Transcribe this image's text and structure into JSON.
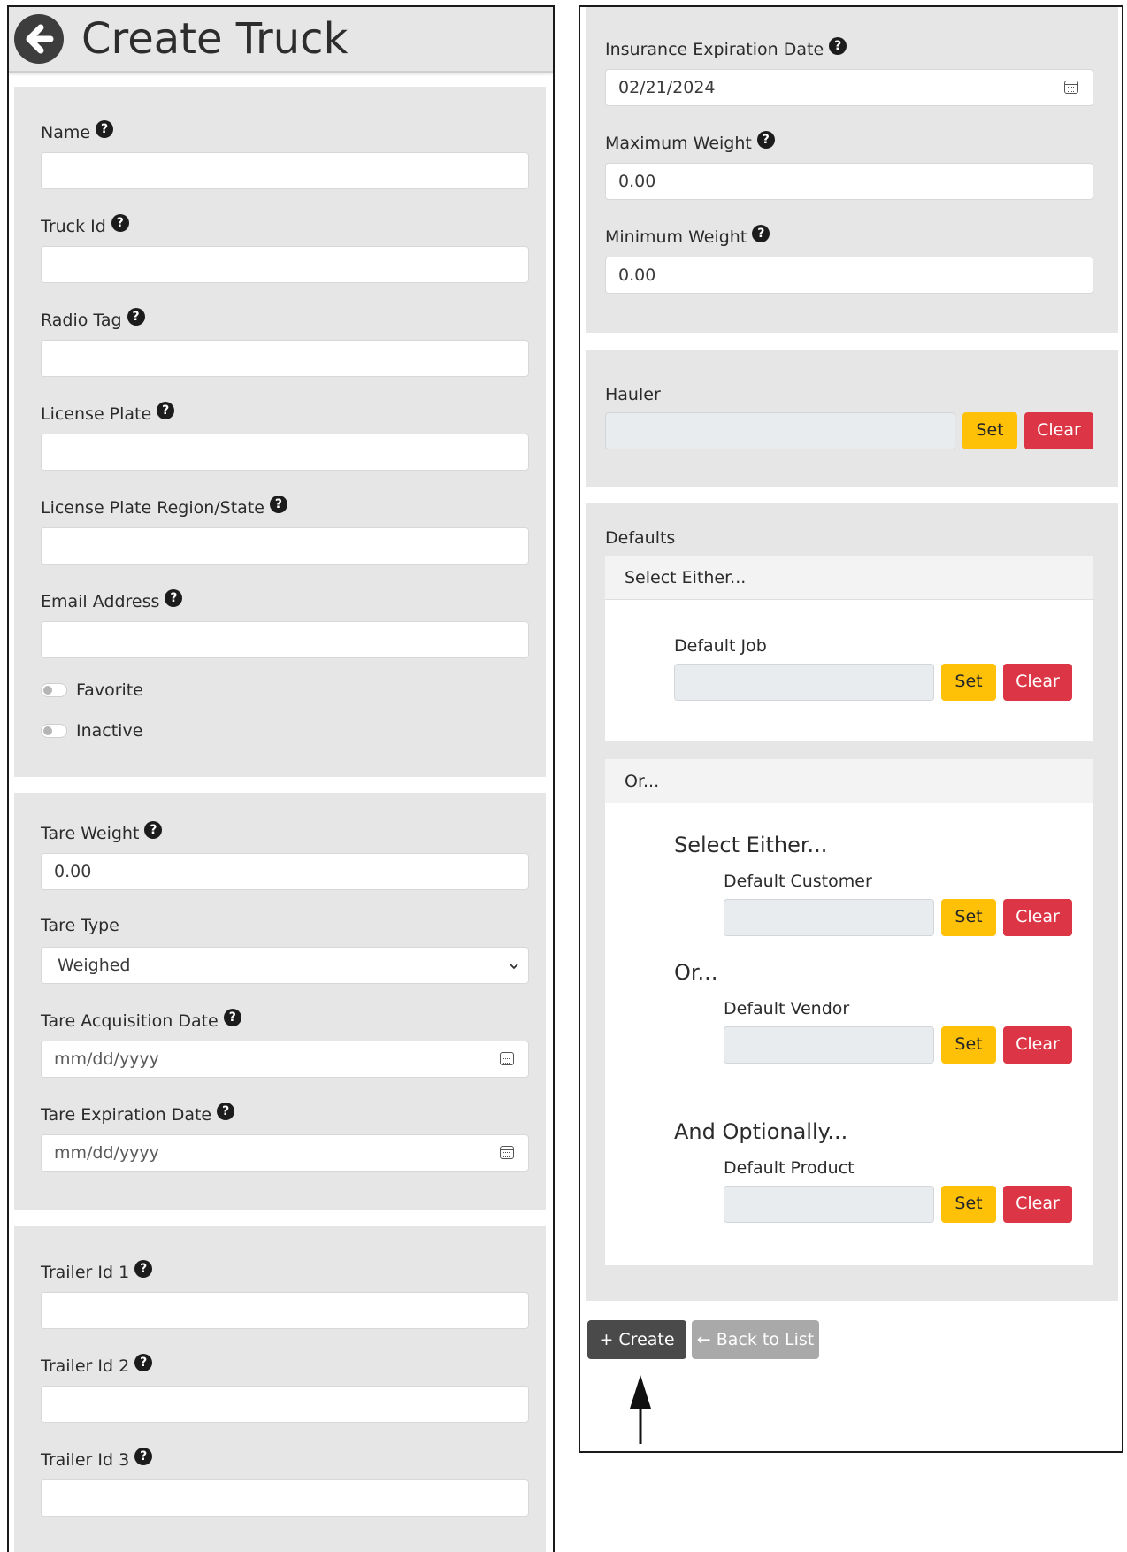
{
  "header": {
    "title": "Create Truck",
    "help_glyph": "?"
  },
  "identity": {
    "name_label": "Name",
    "truck_id_label": "Truck Id",
    "radio_tag_label": "Radio Tag",
    "license_plate_label": "License Plate",
    "license_region_label": "License Plate Region/State",
    "email_label": "Email Address",
    "favorite_label": "Favorite",
    "inactive_label": "Inactive"
  },
  "tare": {
    "weight_label": "Tare Weight",
    "weight_value": "0.00",
    "type_label": "Tare Type",
    "type_value": "Weighed",
    "acq_label": "Tare Acquisition Date",
    "acq_placeholder": "mm/dd/yyyy",
    "exp_label": "Tare Expiration Date",
    "exp_placeholder": "mm/dd/yyyy"
  },
  "trailers": {
    "id1_label": "Trailer Id 1",
    "id2_label": "Trailer Id 2",
    "id3_label": "Trailer Id 3"
  },
  "weights": {
    "insurance_label": "Insurance Expiration Date",
    "insurance_value": "02/21/2024",
    "max_label": "Maximum Weight",
    "max_value": "0.00",
    "min_label": "Minimum Weight",
    "min_value": "0.00"
  },
  "hauler": {
    "label": "Hauler"
  },
  "defaults": {
    "label": "Defaults",
    "select_either": "Select Either...",
    "default_job": "Default Job",
    "or": "Or...",
    "inner_select_either": "Select Either...",
    "default_customer": "Default Customer",
    "inner_or": "Or...",
    "default_vendor": "Default Vendor",
    "and_optionally": "And Optionally...",
    "default_product": "Default Product"
  },
  "buttons": {
    "set": "Set",
    "clear": "Clear",
    "create": "+ Create",
    "back_to_list": "← Back to List"
  }
}
